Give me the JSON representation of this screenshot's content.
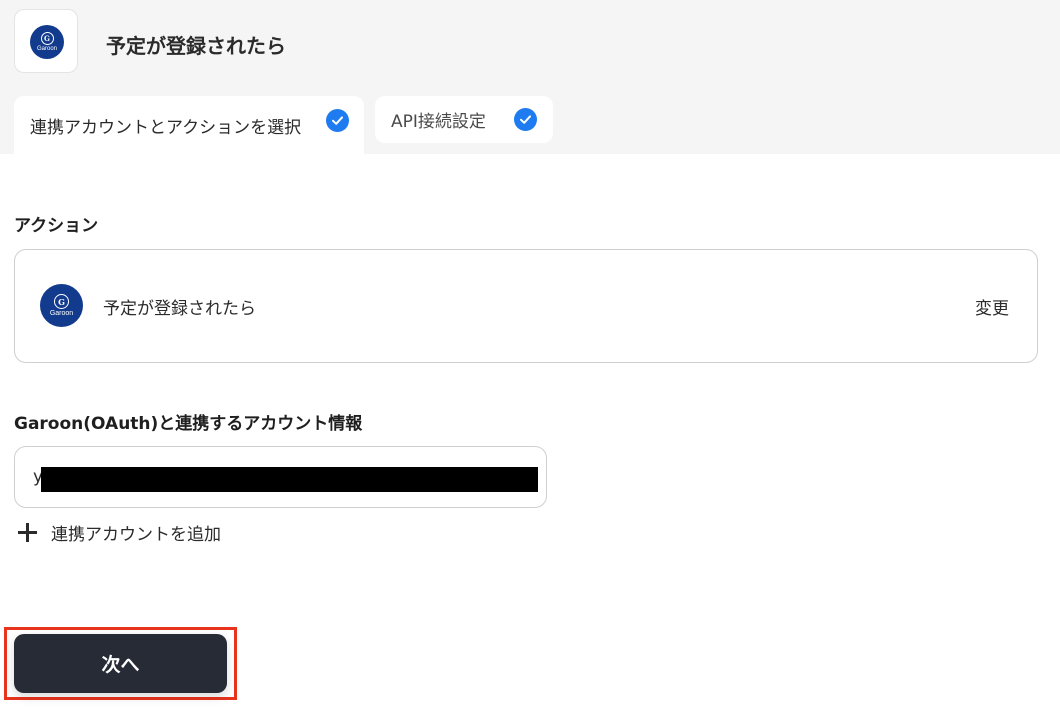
{
  "header": {
    "app_icon": "garoon-logo",
    "logo_letter": "G",
    "logo_word": "Garoon",
    "title": "予定が登録されたら"
  },
  "tabs": [
    {
      "label": "連携アカウントとアクションを選択",
      "completed": true,
      "active": true
    },
    {
      "label": "API接続設定",
      "completed": true,
      "active": false
    }
  ],
  "action_section": {
    "label": "アクション",
    "app_icon": "garoon-logo",
    "logo_letter": "G",
    "logo_word": "Garoon",
    "action_name": "予定が登録されたら",
    "change_label": "変更"
  },
  "account_section": {
    "label": "Garoon(OAuth)と連携するアカウント情報",
    "value": "y",
    "add_account_label": "連携アカウントを追加"
  },
  "footer": {
    "next_label": "次へ"
  },
  "colors": {
    "garoon_blue": "#123b8e",
    "check_blue": "#1e7cf0",
    "next_button_bg": "#262b36",
    "highlight_red": "#e8341c"
  }
}
